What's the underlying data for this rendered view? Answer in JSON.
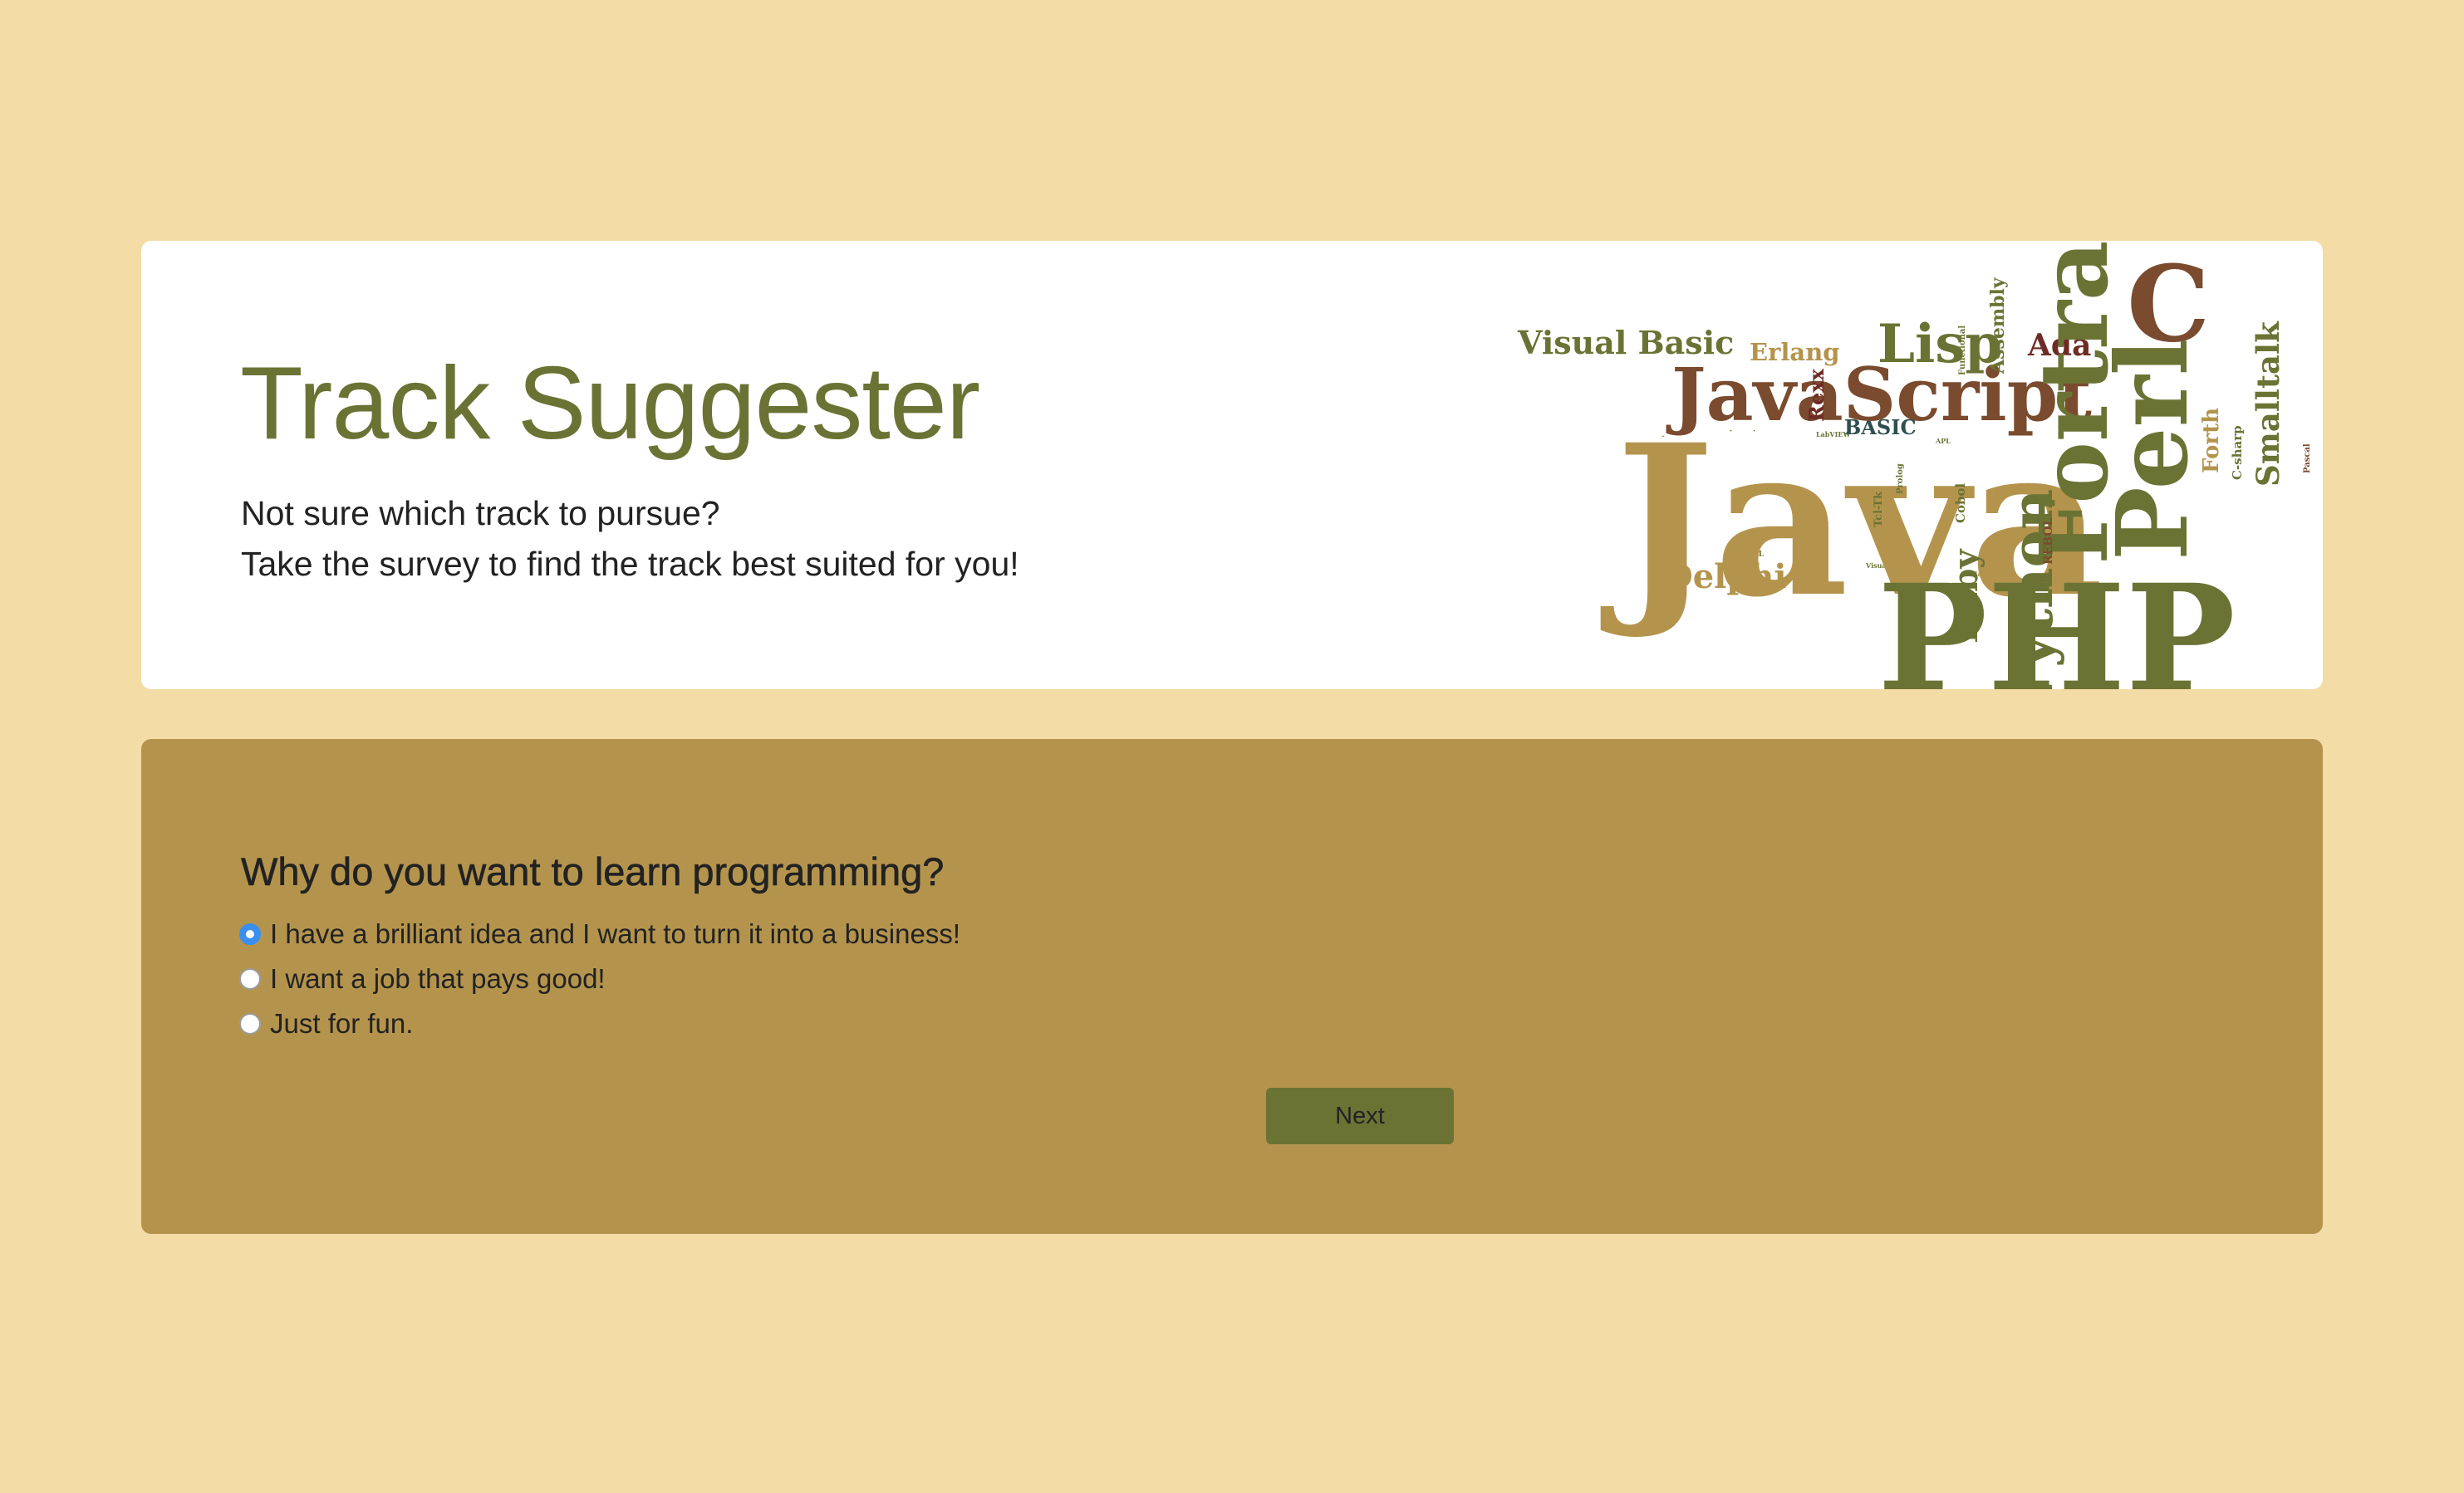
{
  "header": {
    "title": "Track Suggester",
    "subtitle_line1": "Not sure which track to pursue?",
    "subtitle_line2": "Take the survey to find the track best suited for you!"
  },
  "word_cloud": {
    "words": [
      "Java",
      "PHP",
      "JavaScript",
      "Perl",
      "C",
      "Fortran",
      "Lisp",
      "Visual Basic",
      "Python",
      "Delphi",
      "Ruby",
      "Smalltalk",
      "Ada",
      "Erlang",
      "Rexx",
      "Assembly",
      "BASIC",
      "Forth",
      "Cobol",
      "REBOL",
      "Tcl-Tk",
      "C-sharp",
      "LabVIEW",
      "Prolog",
      "Pascal",
      "APL",
      "Visual FoxPro",
      "Haskell",
      "Functional"
    ]
  },
  "survey": {
    "question": "Why do you want to learn programming?",
    "options": [
      {
        "label": "I have a brilliant idea and I want to turn it into a business!",
        "selected": true
      },
      {
        "label": "I want a job that pays good!",
        "selected": false
      },
      {
        "label": "Just for fun.",
        "selected": false
      }
    ],
    "next_label": "Next"
  },
  "colors": {
    "page_background": "#f3dca5",
    "survey_background": "#b4944d",
    "accent_green": "#6b7334",
    "gold": "#b4944d",
    "brown": "#7a4b2e",
    "radio_selected": "#3a8ef0"
  }
}
